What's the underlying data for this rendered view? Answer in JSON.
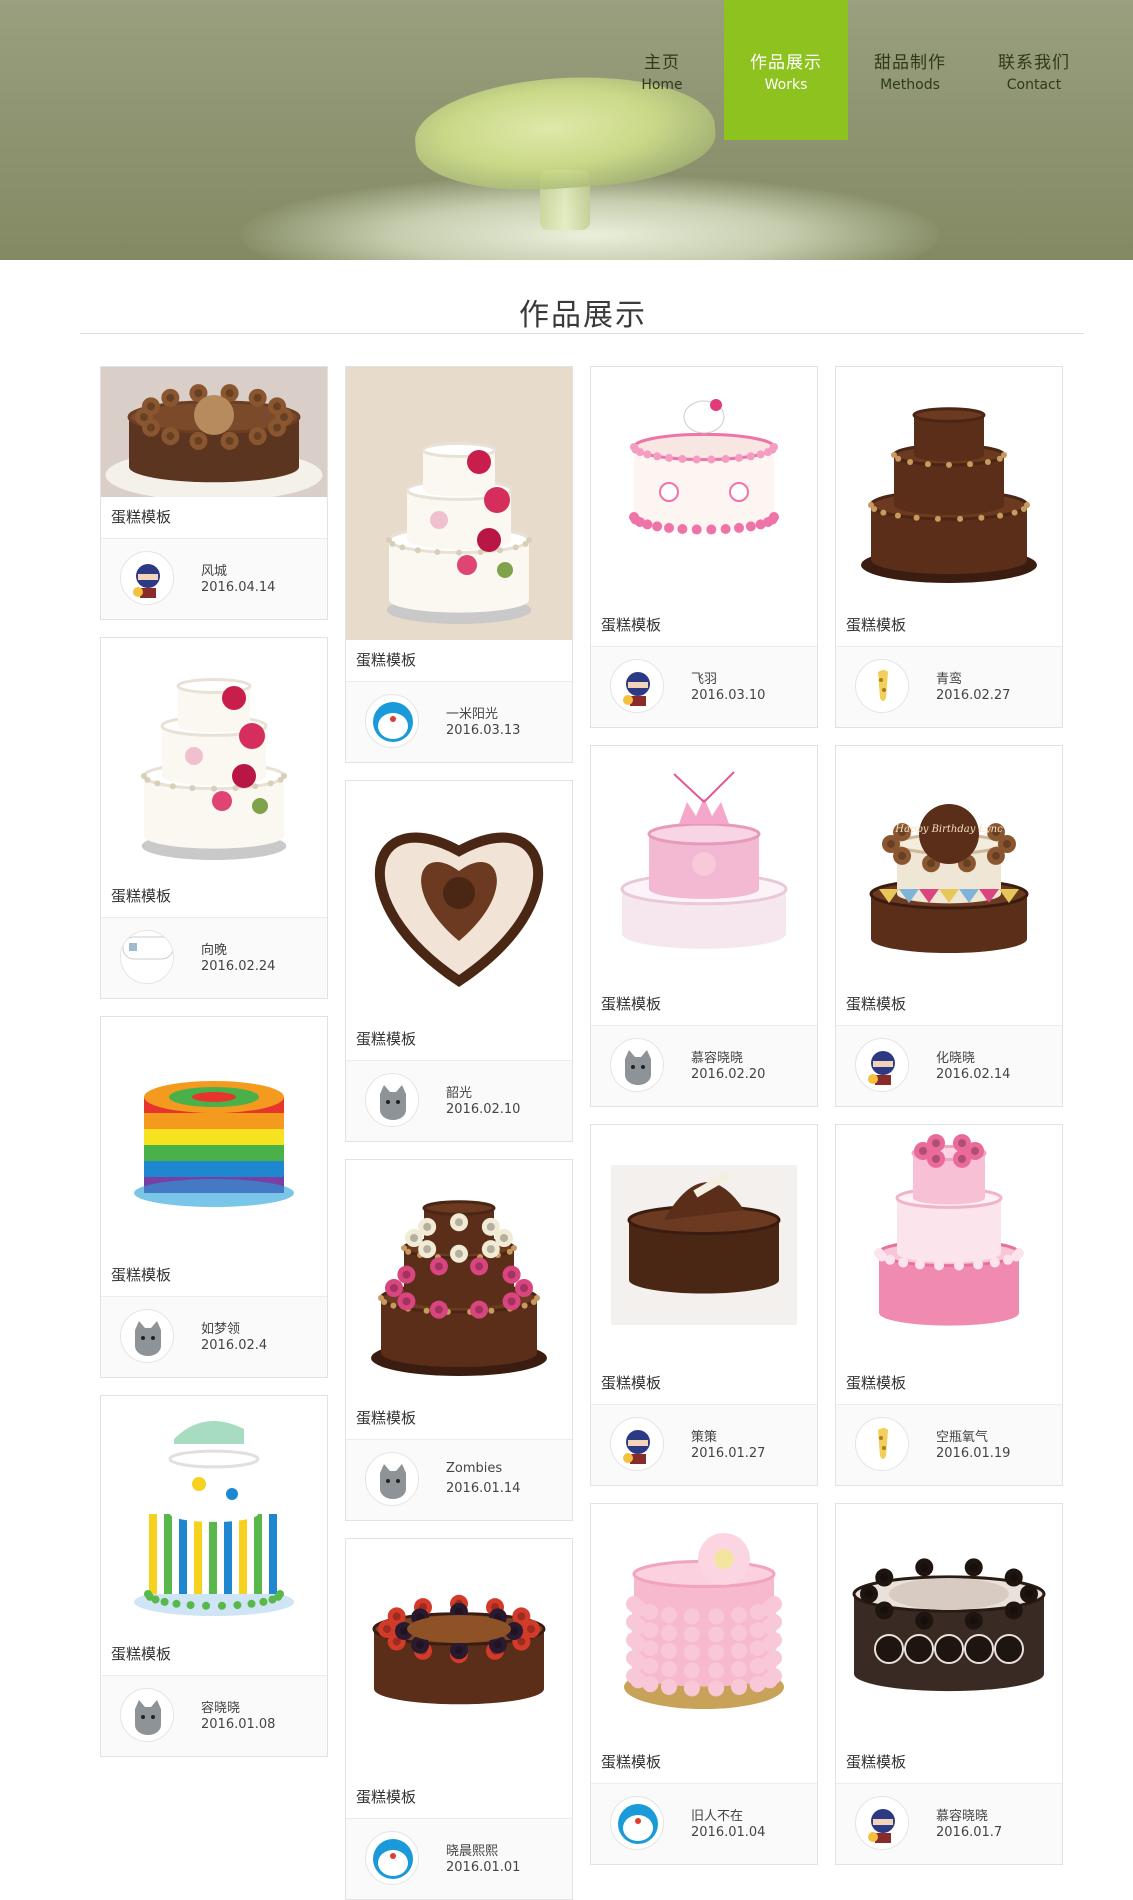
{
  "nav": [
    {
      "zh": "主页",
      "en": "Home",
      "active": false
    },
    {
      "zh": "作品展示",
      "en": "Works",
      "active": true
    },
    {
      "zh": "甜品制作",
      "en": "Methods",
      "active": false
    },
    {
      "zh": "联系我们",
      "en": "Contact",
      "active": false
    }
  ],
  "section_title": "作品展示",
  "colors": {
    "accent": "#8dc21f",
    "hero": "#8f9572"
  },
  "columns": [
    [
      {
        "label": "蛋糕模板",
        "author": "风城",
        "date": "2016.04.14",
        "img": "chocolate-walnut-cake",
        "avatar": "ninja-avatar"
      },
      {
        "label": "蛋糕模板",
        "author": "向晚",
        "date": "2016.02.24",
        "img": "white-flower-tier-cake",
        "avatar": "broken-avatar"
      },
      {
        "label": "蛋糕模板",
        "author": "如梦领",
        "date": "2016.02.4",
        "img": "rainbow-layer-cake",
        "avatar": "cat-avatar"
      },
      {
        "label": "蛋糕模板",
        "author": "容晓晓",
        "date": "2016.01.08",
        "img": "baby-shoe-stripe-cake",
        "avatar": "cat-avatar"
      }
    ],
    [
      {
        "label": "蛋糕模板",
        "author": "一米阳光",
        "date": "2016.03.13",
        "img": "rose-wedding-cake",
        "avatar": "doraemon-avatar"
      },
      {
        "label": "蛋糕模板",
        "author": "韶光",
        "date": "2016.02.10",
        "img": "heart-rose-cake",
        "avatar": "cat-avatar"
      },
      {
        "label": "蛋糕模板",
        "author": "Zombies",
        "date": "2016.01.14",
        "img": "chocolate-rose-tier-cake",
        "avatar": "cat-avatar"
      },
      {
        "label": "蛋糕模板",
        "author": "晓晨熙熙",
        "date": "2016.01.01",
        "img": "berry-chocolate-cake",
        "avatar": "doraemon-avatar"
      }
    ],
    [
      {
        "label": "蛋糕模板",
        "author": "飞羽",
        "date": "2016.03.10",
        "img": "hello-kitty-cake",
        "avatar": "ninja-avatar"
      },
      {
        "label": "蛋糕模板",
        "author": "慕容晓晓",
        "date": "2016.02.20",
        "img": "pink-crown-cake",
        "avatar": "cat-avatar"
      },
      {
        "label": "蛋糕模板",
        "author": "策策",
        "date": "2016.01.27",
        "img": "chocolate-curl-cake",
        "avatar": "ninja-avatar"
      },
      {
        "label": "蛋糕模板",
        "author": "旧人不在",
        "date": "2016.01.04",
        "img": "pink-ruffle-cake",
        "avatar": "doraemon-avatar"
      }
    ],
    [
      {
        "label": "蛋糕模板",
        "author": "青鸾",
        "date": "2016.02.27",
        "img": "chocolate-tier-cake",
        "avatar": "giraffe-avatar"
      },
      {
        "label": "蛋糕模板",
        "author": "化晓晓",
        "date": "2016.02.14",
        "img": "birthday-tier-cake",
        "avatar": "ninja-avatar",
        "cake_text": "Happy Birthday Lync"
      },
      {
        "label": "蛋糕模板",
        "author": "空瓶氧气",
        "date": "2016.01.19",
        "img": "pink-floral-tier-cake",
        "avatar": "giraffe-avatar"
      },
      {
        "label": "蛋糕模板",
        "author": "慕容晓晓",
        "date": "2016.01.7",
        "img": "oreo-cake",
        "avatar": "ninja-avatar"
      }
    ]
  ]
}
